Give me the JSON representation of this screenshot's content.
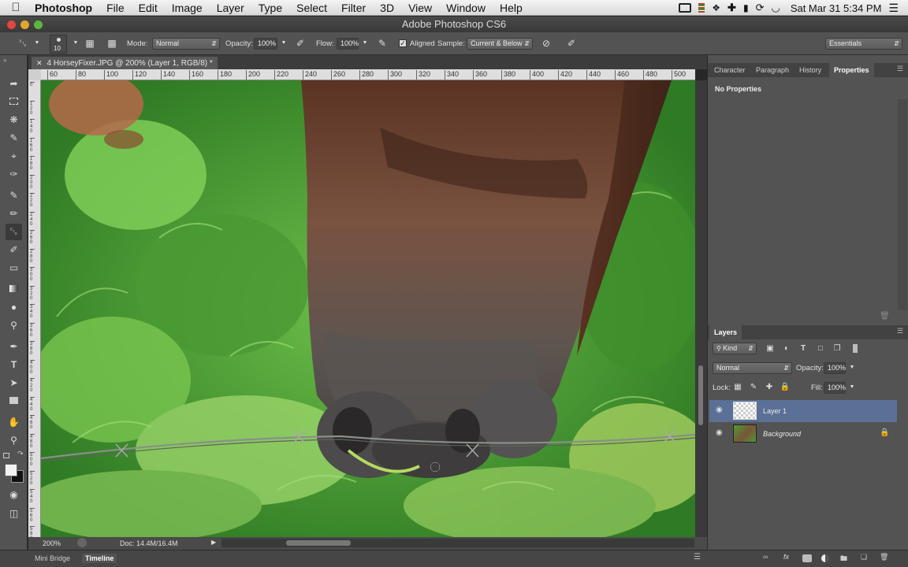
{
  "menubar": {
    "app": "Photoshop",
    "items": [
      "File",
      "Edit",
      "Image",
      "Layer",
      "Type",
      "Select",
      "Filter",
      "3D",
      "View",
      "Window",
      "Help"
    ],
    "clock": "Sat Mar 31  5:34 PM"
  },
  "window": {
    "title": "Adobe Photoshop CS6"
  },
  "options": {
    "brush_size": "10",
    "mode_label": "Mode:",
    "mode_value": "Normal",
    "opacity_label": "Opacity:",
    "opacity_value": "100%",
    "flow_label": "Flow:",
    "flow_value": "100%",
    "aligned_label": "Aligned",
    "sample_label": "Sample:",
    "sample_value": "Current & Below",
    "workspace": "Essentials"
  },
  "document": {
    "tab_title": "4 HorseyFixer.JPG @ 200% (Layer 1, RGB/8) *",
    "zoom": "200%",
    "doc_size": "Doc: 14.4M/16.4M"
  },
  "ruler": {
    "h_ticks": [
      "60",
      "80",
      "100",
      "120",
      "140",
      "160",
      "180",
      "200",
      "220",
      "240",
      "260",
      "280",
      "300",
      "320",
      "340",
      "360",
      "380",
      "400",
      "420",
      "440",
      "460",
      "480",
      "500"
    ],
    "v_ticks": [
      "0",
      "120",
      "140",
      "160",
      "180",
      "200",
      "220",
      "240",
      "260",
      "280",
      "300",
      "320",
      "340",
      "360",
      "380",
      "400",
      "420",
      "440",
      "460",
      "480",
      "500",
      "520",
      "540",
      "560",
      "580"
    ]
  },
  "panels": {
    "top_tabs": [
      "Character",
      "Paragraph",
      "History",
      "Properties"
    ],
    "active_top_tab": "Properties",
    "properties_text": "No Properties",
    "layers_title": "Layers",
    "kind_label": "Kind",
    "blend_mode": "Normal",
    "opacity_label": "Opacity:",
    "opacity_value": "100%",
    "lock_label": "Lock:",
    "fill_label": "Fill:",
    "fill_value": "100%",
    "layers": [
      {
        "name": "Layer 1",
        "selected": true
      },
      {
        "name": "Background",
        "selected": false,
        "locked": true
      }
    ]
  },
  "bottom_tabs": [
    "Mini Bridge",
    "Timeline"
  ],
  "colors": {
    "selection_blue": "#5a7096",
    "panel_bg": "#535353"
  }
}
